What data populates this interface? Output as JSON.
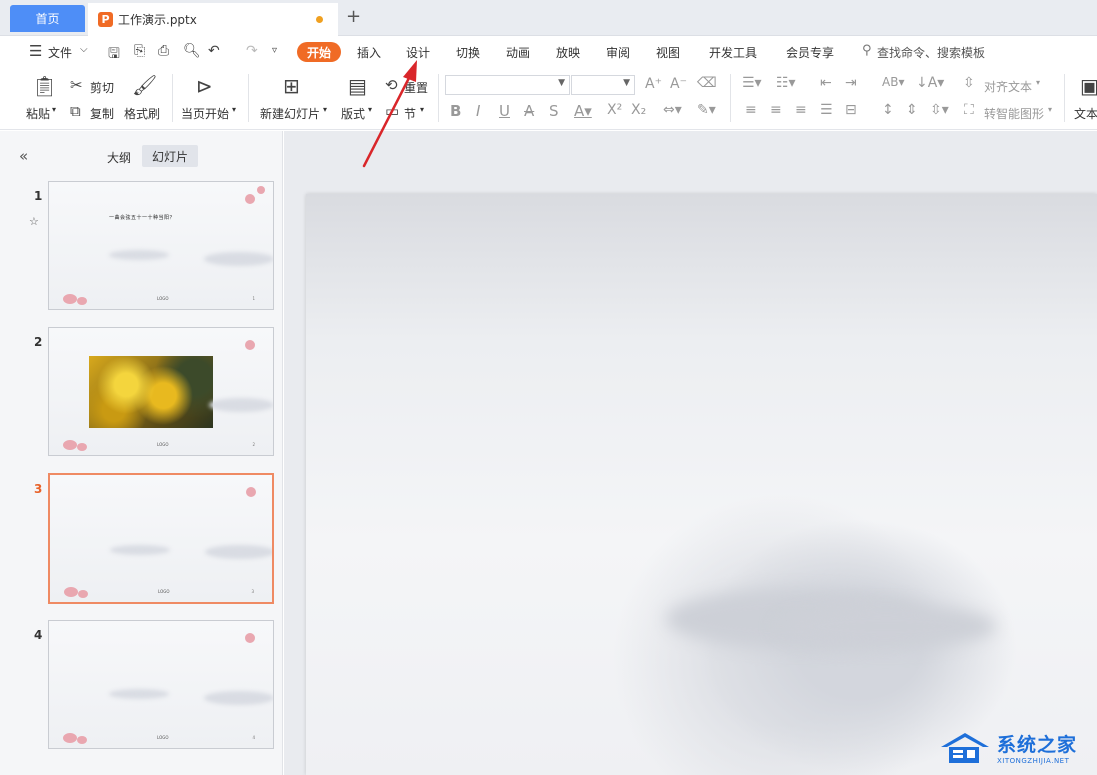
{
  "tabs": {
    "home_label": "首页",
    "doc_title": "工作演示.pptx",
    "new_tab": "+"
  },
  "menu": {
    "file": "文件",
    "start": "开始",
    "items": [
      "插入",
      "设计",
      "切换",
      "动画",
      "放映",
      "审阅",
      "视图",
      "开发工具",
      "会员专享"
    ],
    "search_placeholder": "查找命令、搜索模板"
  },
  "ribbon": {
    "paste": "粘贴",
    "cut": "剪切",
    "copy": "复制",
    "format_painter": "格式刷",
    "from_current": "当页开始",
    "new_slide": "新建幻灯片",
    "layout": "版式",
    "reset": "重置",
    "section": "节",
    "align_text": "对齐文本",
    "smart_art": "转智能图形",
    "text": "文本"
  },
  "left_pane": {
    "outline_label": "大纲",
    "slides_label": "幻灯片",
    "slides": [
      {
        "number": "1",
        "title": "一曲会弦五十一十种当阳？",
        "footer": "LOGO",
        "page": "1"
      },
      {
        "number": "2",
        "footer": "LOGO",
        "page": "2"
      },
      {
        "number": "3",
        "footer": "LOGO",
        "page": "3"
      },
      {
        "number": "4",
        "footer": "LOGO",
        "page": "4"
      }
    ],
    "active_slide": "3"
  },
  "watermark": {
    "name_cn": "系统之家",
    "name_en": "XITONGZHIJIA.NET"
  },
  "colors": {
    "accent_orange": "#f06b25",
    "home_tab_blue": "#4e8ef7",
    "arrow_red": "#d9262a"
  }
}
